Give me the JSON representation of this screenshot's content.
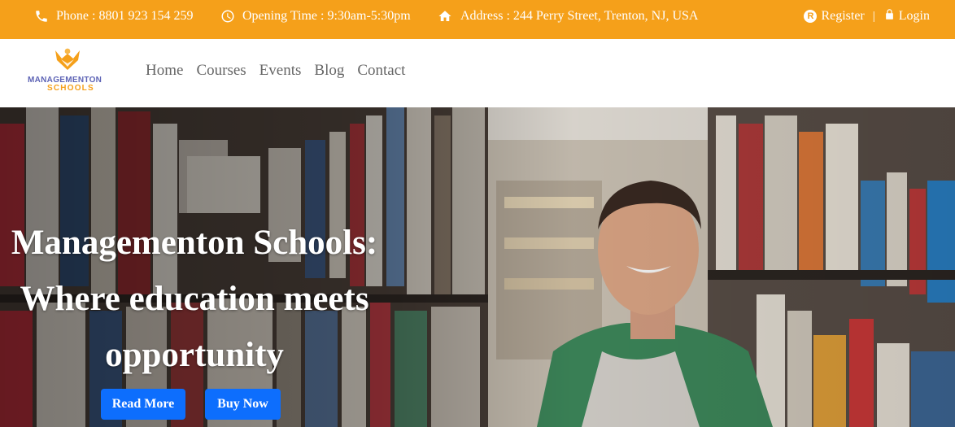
{
  "topbar": {
    "phone_label": "Phone :",
    "phone_value": "8801 923 154 259",
    "hours_label": "Opening Time :",
    "hours_value": "9:30am-5:30pm",
    "address_label": "Address :",
    "address_value": "244 Perry Street, Trenton, NJ, USA",
    "register_label": "Register",
    "login_label": "Login",
    "divider": "|",
    "register_badge": "R"
  },
  "brand": {
    "line1": "MANAGEMENTON",
    "line2": "SCHOOLS"
  },
  "nav": {
    "items": [
      "Home",
      "Courses",
      "Events",
      "Blog",
      "Contact"
    ]
  },
  "hero": {
    "title_line1": "Managementon Schools:",
    "title_line2": "Where education meets",
    "title_line3": "opportunity",
    "read_more": "Read More",
    "buy_now": "Buy Now"
  },
  "colors": {
    "accent": "#f5a01a",
    "button": "#0d6efd",
    "brand_blue": "#5d63b5"
  }
}
